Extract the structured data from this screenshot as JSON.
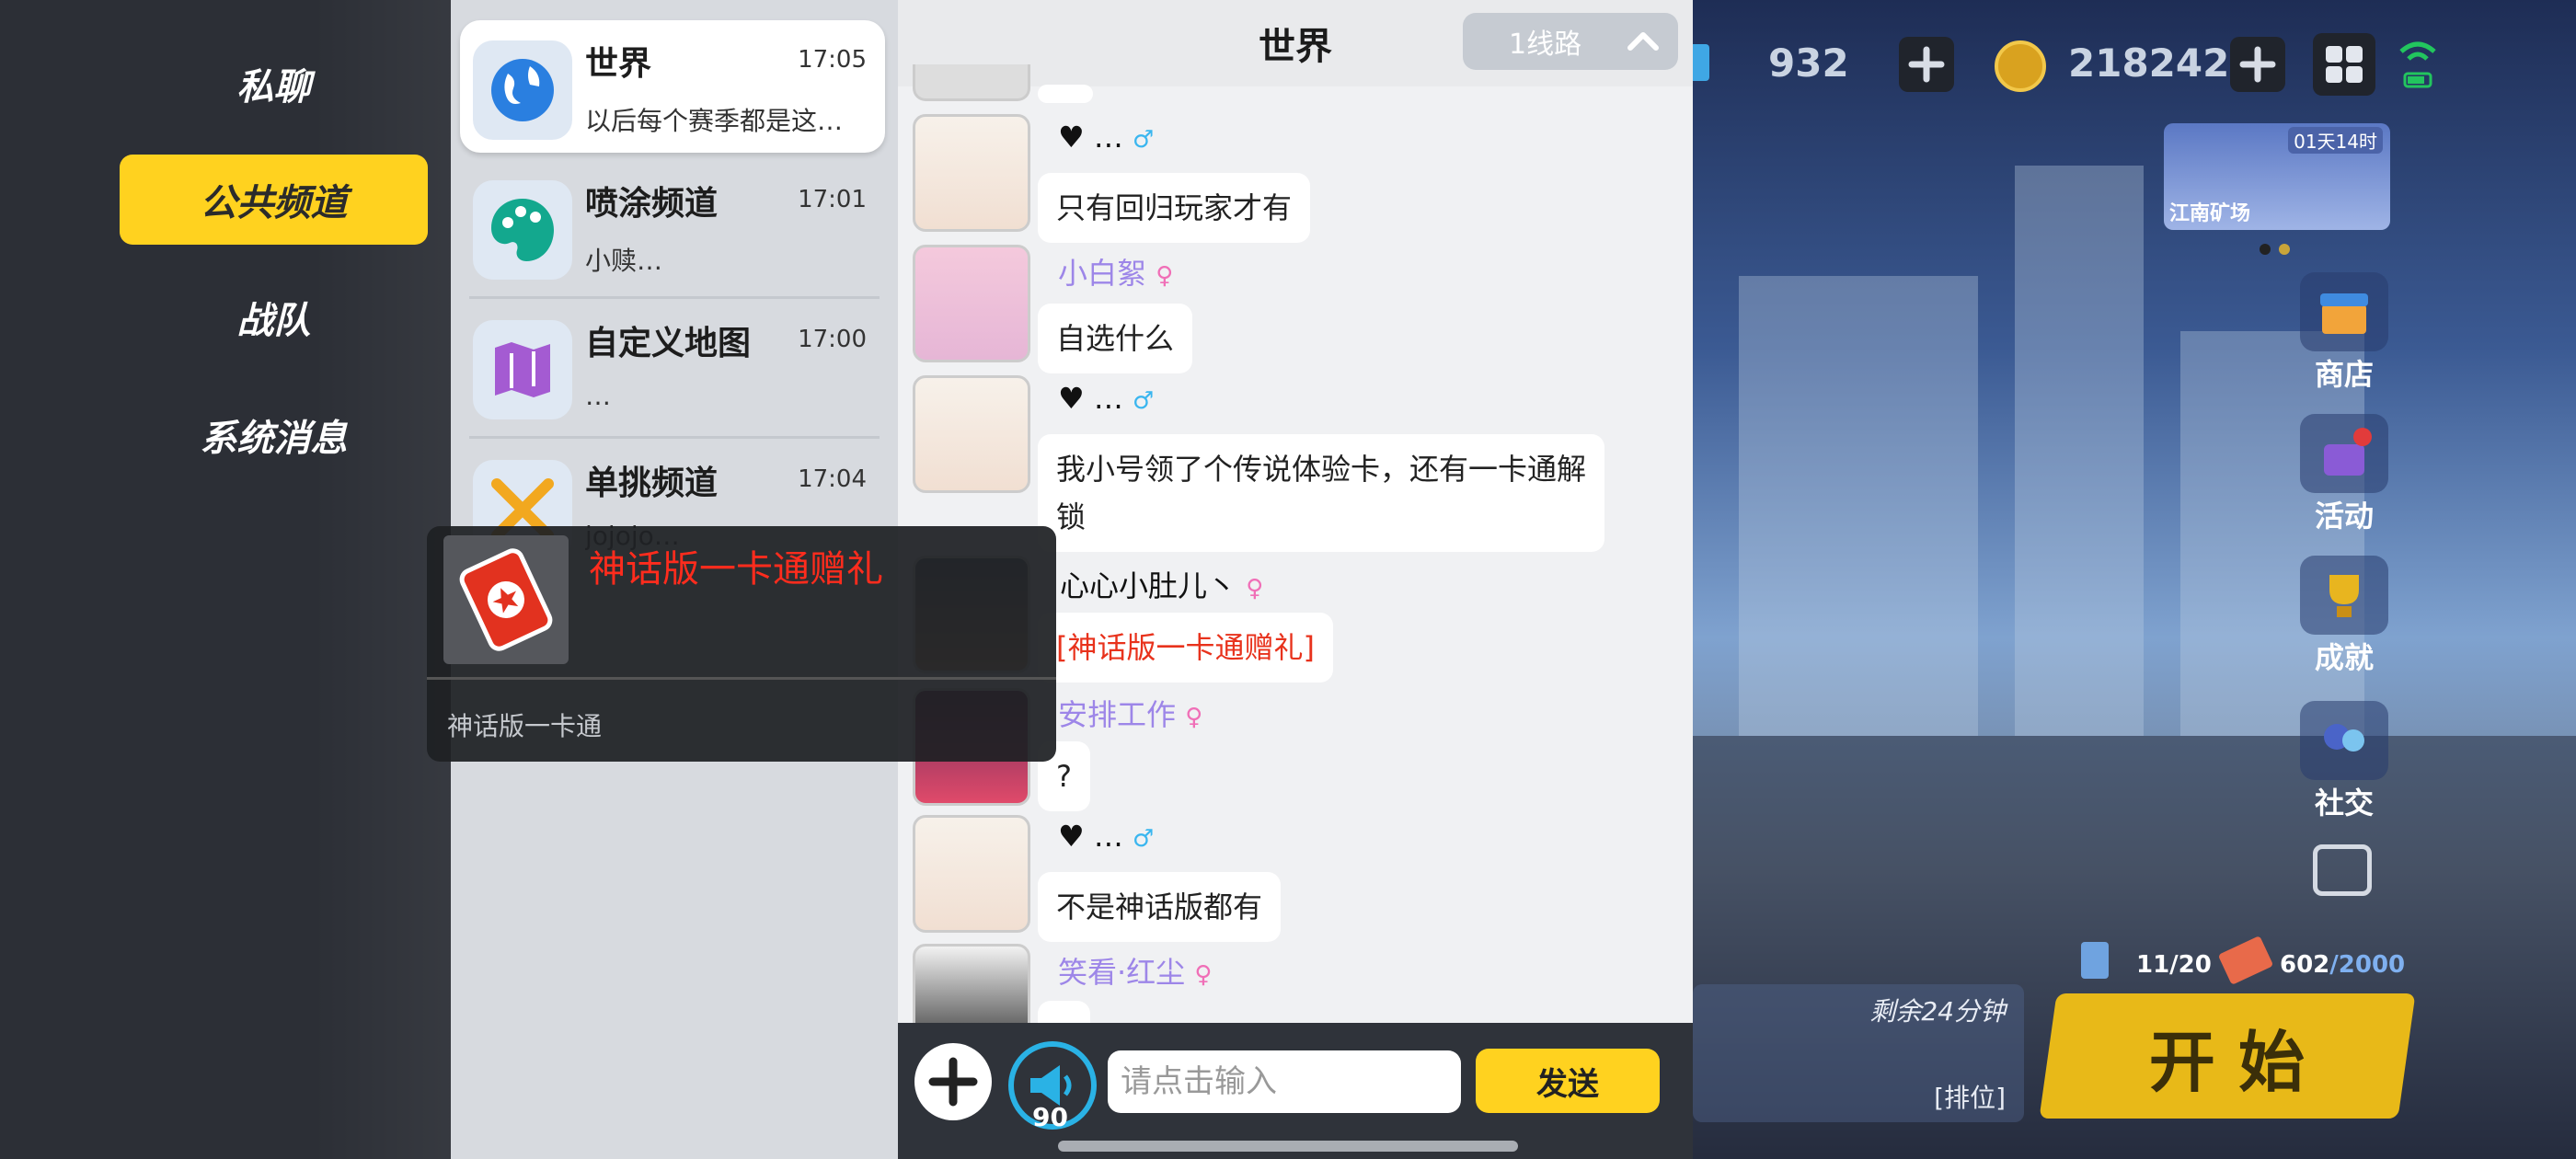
{
  "nav": {
    "items": [
      {
        "label": "私聊"
      },
      {
        "label": "公共频道"
      },
      {
        "label": "战队"
      },
      {
        "label": "系统消息"
      }
    ]
  },
  "channels": [
    {
      "name": "世界",
      "time": "17:05",
      "preview": "以后每个赛季都是这…"
    },
    {
      "name": "喷涂频道",
      "time": "17:01",
      "preview": "小赎…"
    },
    {
      "name": "自定义地图",
      "time": "17:00",
      "preview": "…"
    },
    {
      "name": "单挑频道",
      "time": "17:04",
      "preview": "jojojo…"
    }
  ],
  "chat": {
    "title": "世界",
    "line_label": "1线路",
    "messages": [
      {
        "name": "♥ …",
        "gender": "♂",
        "text": "只有回归玩家才有"
      },
      {
        "name": "小白絮",
        "gender": "♀",
        "text": "自选什么"
      },
      {
        "name": "♥ …",
        "gender": "♂",
        "text": "我小号领了个传说体验卡，还有一卡通解锁"
      },
      {
        "name": "心心小肚儿丶",
        "gender": "♀",
        "text": "[神话版一卡通赠礼]"
      },
      {
        "name": "安排工作",
        "gender": "♀",
        "text": "?"
      },
      {
        "name": "♥ …",
        "gender": "♂",
        "text": "不是神话版都有"
      },
      {
        "name": "笑看·红尘",
        "gender": "♀",
        "text": "?"
      }
    ]
  },
  "input": {
    "placeholder": "请点击输入",
    "send_label": "发送",
    "horn_count": "90"
  },
  "popup": {
    "title": "神话版一卡通赠礼",
    "desc": "神话版一卡通"
  },
  "hud": {
    "diamonds": "932",
    "coins": "218242",
    "event_timer": "01天14时",
    "event_name": "江南矿场",
    "shop": "商店",
    "activity": "活动",
    "achievement": "成就",
    "social": "社交",
    "stat1": "11/20",
    "stat2a": "602",
    "stat2b": "/2000",
    "remain": "剩余24分钟",
    "rank_mode": "[排位]",
    "start": "开 始"
  },
  "colors": {
    "accent": "#ffd21f",
    "red": "#ff2c1d",
    "name_purple": "#9d86e8"
  }
}
